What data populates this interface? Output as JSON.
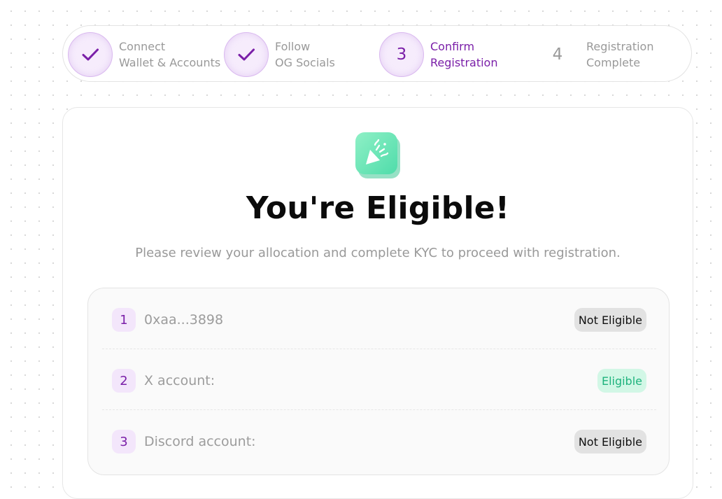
{
  "stepper": {
    "steps": [
      {
        "number": "",
        "line1": "Connect",
        "line2": "Wallet & Accounts",
        "state": "done",
        "icon": "check-icon"
      },
      {
        "number": "",
        "line1": "Follow",
        "line2": "OG Socials",
        "state": "done",
        "icon": "check-icon"
      },
      {
        "number": "3",
        "line1": "Confirm",
        "line2": "Registration",
        "state": "current"
      },
      {
        "number": "4",
        "line1": "Registration",
        "line2": "Complete",
        "state": "pending"
      }
    ]
  },
  "card": {
    "icon": "party-popper-icon",
    "title": "You're Eligible!",
    "subtitle": "Please review your allocation and complete KYC to proceed with registration."
  },
  "eligibility": [
    {
      "index": "1",
      "label": "0xaa...3898",
      "status": "Not Eligible",
      "eligible": false
    },
    {
      "index": "2",
      "label": "X account:",
      "status": "Eligible",
      "eligible": true
    },
    {
      "index": "3",
      "label": "Discord account:",
      "status": "Not Eligible",
      "eligible": false
    }
  ],
  "colors": {
    "accent_purple": "#7a1fa8",
    "eligible_green": "#1fb37d",
    "eligible_bg": "#d2f7e6",
    "not_eligible_bg": "#e2e2e2"
  }
}
